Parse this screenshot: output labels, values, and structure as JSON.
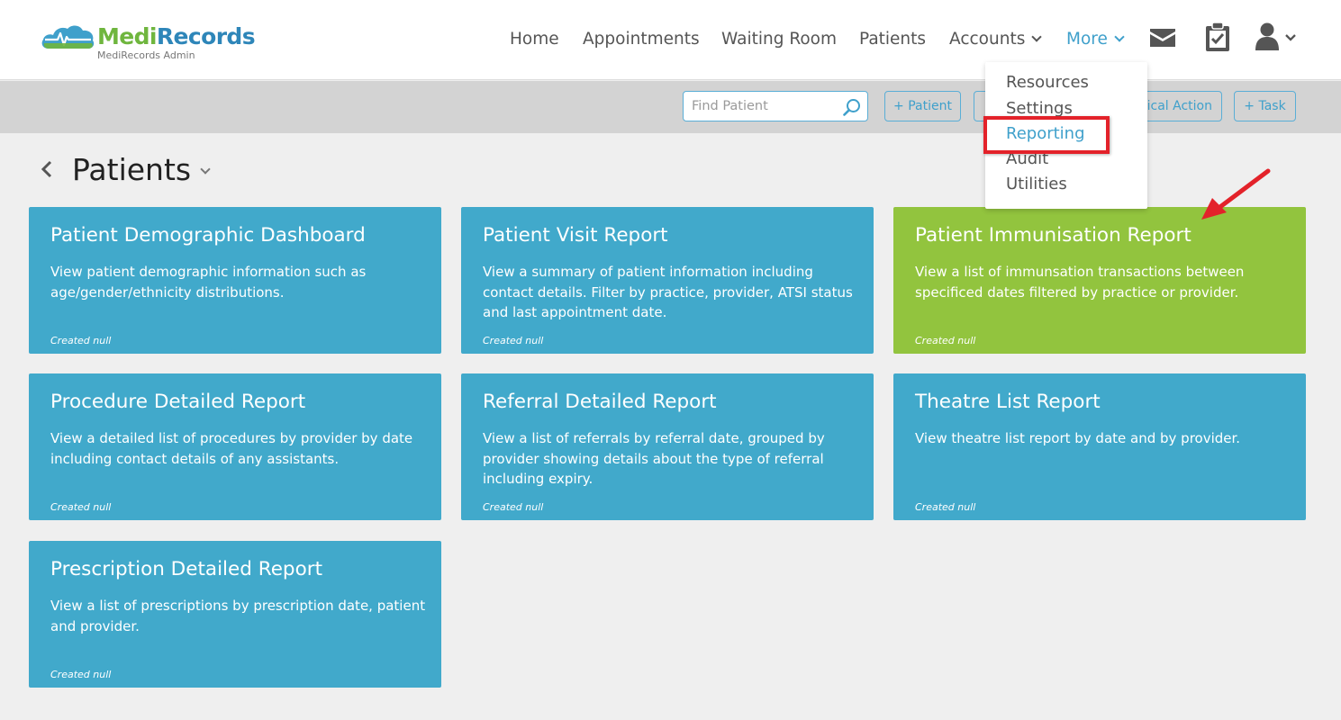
{
  "brand": {
    "name_part1": "Medi",
    "name_part2": "Records",
    "subtitle": "MediRecords Admin",
    "color_green": "#6fb63e",
    "color_blue": "#2e86b9"
  },
  "nav": {
    "items": [
      {
        "label": "Home"
      },
      {
        "label": "Appointments"
      },
      {
        "label": "Waiting Room"
      },
      {
        "label": "Patients"
      },
      {
        "label": "Accounts"
      },
      {
        "label": "More"
      }
    ],
    "icons": [
      "mail-icon",
      "clipboard-check-icon",
      "user-icon"
    ]
  },
  "more_menu": {
    "items": [
      {
        "label": "Resources"
      },
      {
        "label": "Settings"
      },
      {
        "label": "Reporting"
      },
      {
        "label": "Audit"
      },
      {
        "label": "Utilities"
      }
    ],
    "selected": "Reporting"
  },
  "toolbar": {
    "search_placeholder": "Find Patient",
    "buttons": [
      {
        "label": "+ Patient"
      },
      {
        "label": "ical Action"
      },
      {
        "label": "+ Task"
      }
    ]
  },
  "page": {
    "title": "Patients"
  },
  "reports": [
    {
      "title": "Patient Demographic Dashboard",
      "description": "View patient demographic information such as age/gender/ethnicity distributions.",
      "meta": "Created null",
      "color": "#41a9cb"
    },
    {
      "title": "Patient Visit Report",
      "description": "View a summary of patient information including contact details. Filter by practice, provider, ATSI status and last appointment date.",
      "meta": "Created null",
      "color": "#41a9cb"
    },
    {
      "title": "Patient Immunisation Report",
      "description": "View a list of immunsation transactions between specificed dates filtered by practice or provider.",
      "meta": "Created null",
      "color": "#92c43e"
    },
    {
      "title": "Procedure Detailed Report",
      "description": "View a detailed list of procedures by provider by date including contact details of any assistants.",
      "meta": "Created null",
      "color": "#41a9cb"
    },
    {
      "title": "Referral Detailed Report",
      "description": "View a list of referrals by referral date, grouped by provider showing details about the type of referral including expiry.",
      "meta": "Created null",
      "color": "#41a9cb"
    },
    {
      "title": "Theatre List Report",
      "description": "View theatre list report by date and by provider.",
      "meta": "Created null",
      "color": "#41a9cb"
    },
    {
      "title": "Prescription Detailed Report",
      "description": "View a list of prescriptions by prescription date, patient and provider.",
      "meta": "Created null",
      "color": "#41a9cb"
    }
  ],
  "annotation": {
    "highlight_color": "#e3222a"
  }
}
